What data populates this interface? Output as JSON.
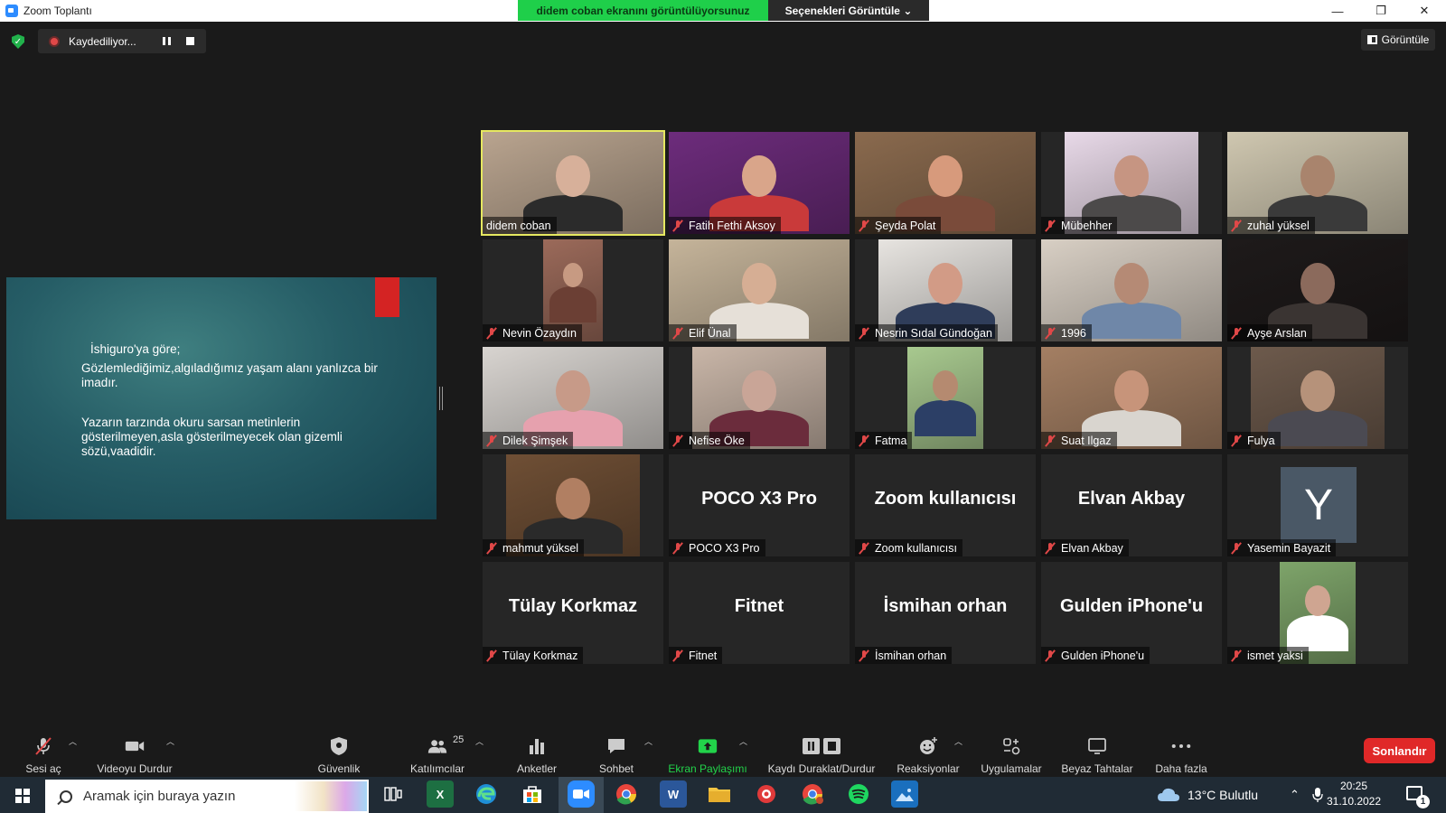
{
  "window": {
    "title": "Zoom Toplantı",
    "sharing_banner": "didem coban ekranını görüntülüyorsunuz",
    "view_options": "Seçenekleri Görüntüle",
    "controls": {
      "minimize": "—",
      "restore": "❐",
      "close": "✕"
    }
  },
  "recording": {
    "label": "Kaydediliyor..."
  },
  "view_button": {
    "label": "Görüntüle"
  },
  "slide": {
    "line1": "İshiguro'ya göre;",
    "line2": "Gözlemlediğimiz,algıladığımız yaşam alanı yanlızca bir imadır.",
    "line3": "Yazarın tarzında okuru sarsan metinlerin gösterilmeyen,asla gösterilmeyecek olan gizemli sözü,vaadidir."
  },
  "participants": [
    {
      "name": "didem coban",
      "muted": false,
      "active": true,
      "video": true,
      "bg": "#b9a48f",
      "skin": "#d7b09a",
      "shirt": "#2b2b2b"
    },
    {
      "name": "Fatih Fethi Aksoy",
      "muted": true,
      "video": true,
      "bg": "#6d2c7c",
      "skin": "#d9a58a",
      "shirt": "#c93a3a"
    },
    {
      "name": "Şeyda Polat",
      "muted": true,
      "video": true,
      "bg": "#8a6a4e",
      "skin": "#d79a7c",
      "shirt": "#7a4b3a"
    },
    {
      "name": "Mübehher",
      "muted": true,
      "video": true,
      "bg": "#e8d9e8",
      "skin": "#c69582",
      "shirt": "#4c4a4a"
    },
    {
      "name": "zuhal yüksel",
      "muted": true,
      "video": true,
      "bg": "#cfc7b0",
      "skin": "#a9846d",
      "shirt": "#3a3a3a"
    },
    {
      "name": "Nevin Özaydın",
      "muted": true,
      "video": true,
      "bg": "#9b6a5a",
      "skin": "#c79a82",
      "shirt": "#6b3f34"
    },
    {
      "name": "Elif Ünal",
      "muted": true,
      "video": true,
      "bg": "#c5b49a",
      "skin": "#d6ae94",
      "shirt": "#e6e0d8"
    },
    {
      "name": "Nesrin Sıdal Gündoğan",
      "muted": true,
      "video": true,
      "bg": "#e7e4e0",
      "skin": "#d29b86",
      "shirt": "#2f3d5a"
    },
    {
      "name": "1996",
      "muted": true,
      "video": true,
      "bg": "#d8cfc4",
      "skin": "#b58a75",
      "shirt": "#6f87a8"
    },
    {
      "name": "Ayşe Arslan",
      "muted": true,
      "video": true,
      "bg": "#1e1a1a",
      "skin": "#8b6a5c",
      "shirt": "#3a3432"
    },
    {
      "name": "Dilek Şimşek",
      "muted": true,
      "video": true,
      "bg": "#d8d4d0",
      "skin": "#c79a88",
      "shirt": "#e6a1ae"
    },
    {
      "name": "Nefise Öke",
      "muted": true,
      "video": true,
      "bg": "#c9b6a8",
      "skin": "#c9a597",
      "shirt": "#6b2c3c"
    },
    {
      "name": "Fatma",
      "muted": true,
      "video": true,
      "bg": "#a8c98f",
      "skin": "#b58a70",
      "shirt": "#2c3f66"
    },
    {
      "name": "Suat Ilgaz",
      "muted": true,
      "video": true,
      "bg": "#a47f63",
      "skin": "#c7947a",
      "shirt": "#d9d5cf"
    },
    {
      "name": "Fulya",
      "muted": true,
      "video": true,
      "bg": "#6d5a4c",
      "skin": "#b6927a",
      "shirt": "#4b4a52"
    },
    {
      "name": "mahmut yüksel",
      "muted": true,
      "video": true,
      "bg": "#6f4f35",
      "skin": "#b17f62",
      "shirt": "#2a2a2a"
    },
    {
      "name": "POCO X3 Pro",
      "muted": true,
      "video": false,
      "display": "POCO X3 Pro"
    },
    {
      "name": "Zoom kullanıcısı",
      "muted": true,
      "video": false,
      "display": "Zoom kullanıcısı"
    },
    {
      "name": "Elvan Akbay",
      "muted": true,
      "video": false,
      "display": "Elvan Akbay"
    },
    {
      "name": "Yasemin Bayazit",
      "muted": true,
      "video": false,
      "initial": "Y"
    },
    {
      "name": "Tülay Korkmaz",
      "muted": true,
      "video": false,
      "display": "Tülay Korkmaz"
    },
    {
      "name": "Fitnet",
      "muted": true,
      "video": false,
      "display": "Fitnet"
    },
    {
      "name": "İsmihan orhan",
      "muted": true,
      "video": false,
      "display": "İsmihan orhan"
    },
    {
      "name": "Gulden iPhone'u",
      "muted": true,
      "video": false,
      "display": "Gulden iPhone'u"
    },
    {
      "name": "ismet yaksi",
      "muted": true,
      "video": true,
      "bg": "#7ea46a",
      "skin": "#cfa591",
      "shirt": "#ffffff"
    }
  ],
  "toolbar": {
    "unmute": "Sesi aç",
    "stop_video": "Videoyu Durdur",
    "security": "Güvenlik",
    "participants": "Katılımcılar",
    "participant_count": "25",
    "polls": "Anketler",
    "chat": "Sohbet",
    "share": "Ekran Paylaşımı",
    "pause_record": "Kaydı Duraklat/Durdur",
    "reactions": "Reaksiyonlar",
    "apps": "Uygulamalar",
    "whiteboards": "Beyaz Tahtalar",
    "more": "Daha fazla",
    "end": "Sonlandır"
  },
  "taskbar": {
    "search_placeholder": "Aramak için buraya yazın",
    "weather": "13°C  Bulutlu",
    "time": "20:25",
    "date": "31.10.2022",
    "notifications": "1"
  },
  "colors": {
    "accent_green": "#22d34a",
    "end_red": "#e02828",
    "active_outline": "#e6e860"
  }
}
